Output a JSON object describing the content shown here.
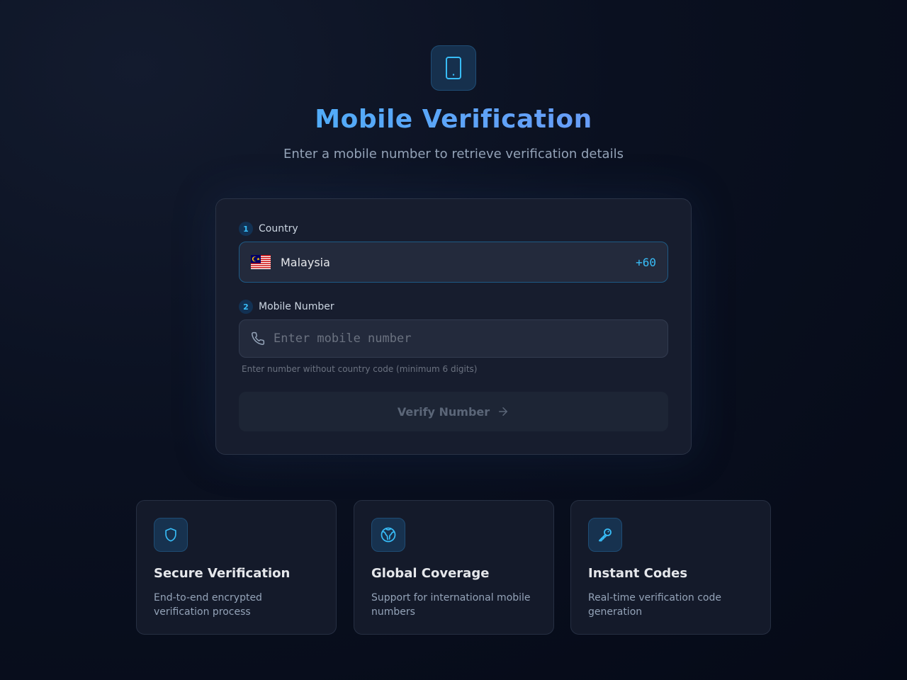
{
  "header": {
    "icon": "smartphone-icon",
    "title": "Mobile Verification",
    "subtitle": "Enter a mobile number to retrieve verification details"
  },
  "form": {
    "country": {
      "step": "1",
      "label": "Country",
      "selected_country": "Malaysia",
      "dial_code": "+60",
      "flag": "malaysia-flag-icon"
    },
    "mobile": {
      "step": "2",
      "label": "Mobile Number",
      "placeholder": "Enter mobile number",
      "value": "",
      "hint": "Enter number without country code (minimum 6 digits)",
      "icon": "phone-icon"
    },
    "submit": {
      "label": "Verify Number",
      "icon": "arrow-right-icon",
      "disabled": true
    }
  },
  "features": [
    {
      "icon": "shield-icon",
      "title": "Secure Verification",
      "description": "End-to-end encrypted verification process"
    },
    {
      "icon": "globe-icon",
      "title": "Global Coverage",
      "description": "Support for international mobile numbers"
    },
    {
      "icon": "key-icon",
      "title": "Instant Codes",
      "description": "Real-time verification code generation"
    }
  ],
  "colors": {
    "accent": "#38bdf8",
    "accent_secondary": "#818cf8",
    "background": "#0a1020",
    "card": "#171d2e"
  }
}
